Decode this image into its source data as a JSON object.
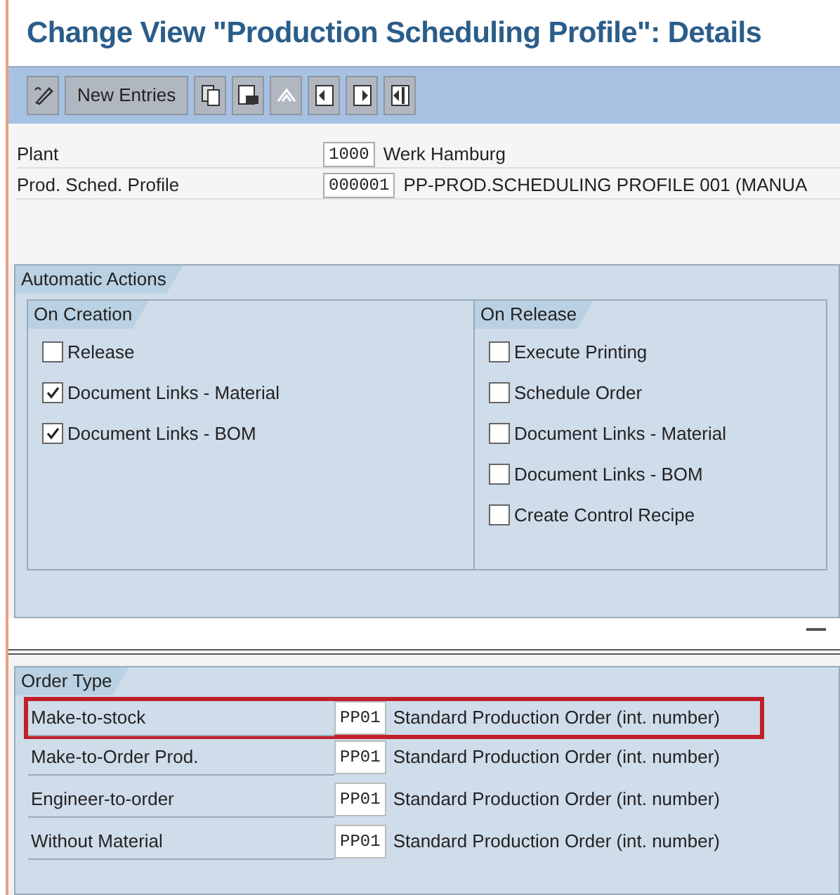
{
  "window": {
    "title": "Change View \"Production Scheduling Profile\": Details"
  },
  "toolbar": {
    "buttons": [
      {
        "kind": "icon"
      },
      {
        "kind": "text",
        "label": "New Entries"
      },
      {
        "kind": "icon"
      },
      {
        "kind": "icon"
      },
      {
        "kind": "icon"
      },
      {
        "kind": "icon"
      },
      {
        "kind": "icon"
      },
      {
        "kind": "icon"
      }
    ]
  },
  "fields": [
    {
      "label": "Plant",
      "value": "1000",
      "description": "Werk Hamburg"
    },
    {
      "label": "Prod. Sched. Profile",
      "value": "000001",
      "description": "PP-PROD.SCHEDULING PROFILE 001 (MANUA"
    }
  ],
  "automatic_actions": {
    "title": "Automatic Actions",
    "groups": [
      {
        "title": "On Creation",
        "items": [
          {
            "label": "Release",
            "checked": false
          },
          {
            "label": "Document Links - Material",
            "checked": true
          },
          {
            "label": "Document Links - BOM",
            "checked": true
          }
        ]
      },
      {
        "title": "On Release",
        "items": [
          {
            "label": "Execute Printing",
            "checked": false
          },
          {
            "label": "Schedule Order",
            "checked": false
          },
          {
            "label": "Document Links - Material",
            "checked": false
          },
          {
            "label": "Document Links - BOM",
            "checked": false
          },
          {
            "label": "Create Control Recipe",
            "checked": false
          }
        ]
      }
    ]
  },
  "order_type": {
    "title": "Order Type",
    "rows": [
      {
        "label": "Make-to-stock",
        "value": "PP01",
        "description": "Standard Production Order (int. number)",
        "highlighted": true
      },
      {
        "label": "Make-to-Order Prod.",
        "value": "PP01",
        "description": "Standard Production Order (int. number)",
        "highlighted": false
      },
      {
        "label": "Engineer-to-order",
        "value": "PP01",
        "description": "Standard Production Order (int. number)",
        "highlighted": false
      },
      {
        "label": "Without Material",
        "value": "PP01",
        "description": "Standard Production Order (int. number)",
        "highlighted": false
      }
    ]
  }
}
